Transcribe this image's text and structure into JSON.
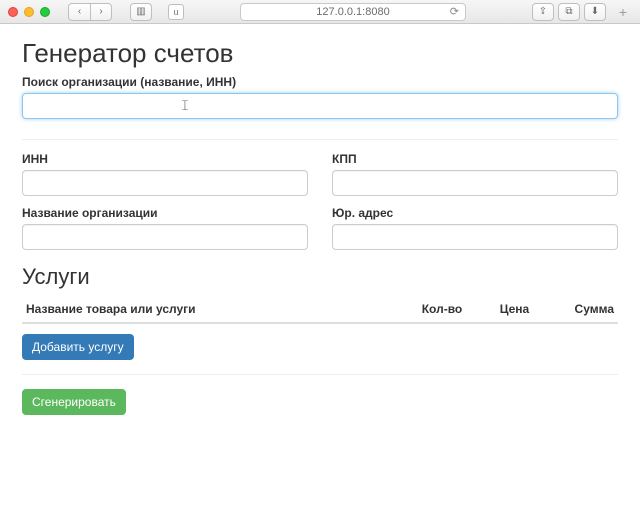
{
  "browser": {
    "address": "127.0.0.1:8080",
    "tab_label": "u"
  },
  "page": {
    "title": "Генератор счетов",
    "search_label": "Поиск организации (название, ИНН)",
    "search_value": "",
    "fields": {
      "inn_label": "ИНН",
      "inn_value": "",
      "kpp_label": "КПП",
      "kpp_value": "",
      "orgname_label": "Название организации",
      "orgname_value": "",
      "legaladdr_label": "Юр. адрес",
      "legaladdr_value": ""
    },
    "services": {
      "heading": "Услуги",
      "columns": {
        "name": "Название товара или услуги",
        "qty": "Кол-во",
        "price": "Цена",
        "sum": "Сумма"
      },
      "add_button": "Добавить услугу"
    },
    "generate_button": "Сгенерировать"
  }
}
